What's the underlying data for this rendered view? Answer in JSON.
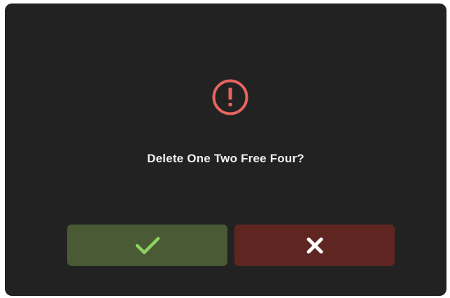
{
  "dialog": {
    "message": "Delete One Two Free Four?",
    "warning_icon": "exclamation-circle-icon",
    "confirm_button": {
      "icon": "checkmark-icon",
      "color": "#4a5a35",
      "icon_color": "#8cd35f"
    },
    "cancel_button": {
      "icon": "close-x-icon",
      "color": "#5f2521",
      "icon_color": "#ffffff"
    },
    "warning_color": "#e8645e",
    "background": "#222222"
  }
}
